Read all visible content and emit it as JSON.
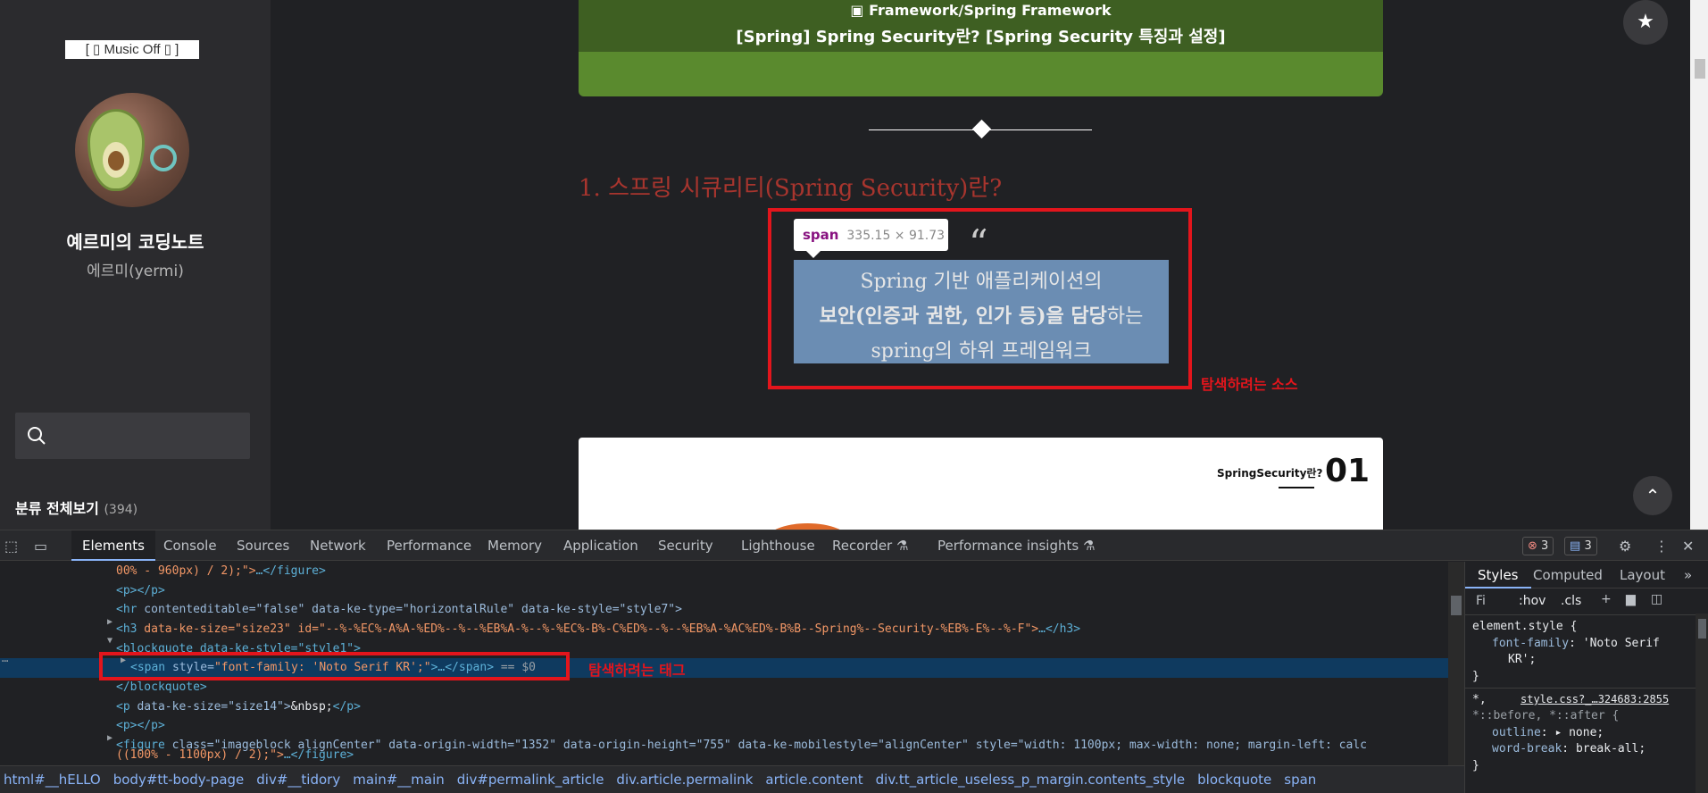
{
  "sidebar": {
    "music_label": "[ ▯ Music Off ▯ ]",
    "blog_title": "예르미의 코딩노트",
    "owner": "에르미(yermi)",
    "category_label": "분류 전체보기",
    "category_count": "(394)"
  },
  "article": {
    "category": "▣ Framework/Spring Framework",
    "title": "[Spring] Spring Security란? [Spring Security 특징과 설정]",
    "heading": "1. 스프링 시큐리티(Spring Security)란?",
    "quote_mark": "“",
    "quote_line1": "Spring 기반 애플리케이션의",
    "quote_line2_bold1": "보안(인증과 권한, 인가 등)을 담당",
    "quote_line2_rest": "하는",
    "quote_line3": "spring의 하위 프레임워크",
    "card_label": "SpringSecurity란?",
    "card_num": "01"
  },
  "inspect_tooltip": {
    "tag": "span",
    "size": "335.15 × 91.73"
  },
  "annotations": {
    "source": "탐색하려는 소스",
    "tag": "탐색하려는 태그"
  },
  "devtools": {
    "tabs": [
      "Elements",
      "Console",
      "Sources",
      "Network",
      "Performance",
      "Memory",
      "Application",
      "Security",
      "Lighthouse",
      "Recorder ⚗",
      "Performance insights ⚗"
    ],
    "errors": "3",
    "messages": "3",
    "code": {
      "l1_text": "00% - 960px) / 2);\">",
      "l1_close": "…</figure>",
      "l2": "<p></p>",
      "l3_tag": "<hr",
      "l3_attrs": " contenteditable=\"false\" data-ke-type=\"horizontalRule\" data-ke-style=\"style7\">",
      "l4_tag": "<h3",
      "l4_attrs": " data-ke-size=\"size23\" id=\"--%-%EC%-A%A-%ED%--%--%EB%A-%--%-%EC%-B%-C%ED%--%--%EB%A-%AC%ED%-B%B--Spring%--Security-%EB%-E%--%-F\">",
      "l4_close": "…</h3>",
      "l5": "<blockquote data-ke-style=\"style1\">",
      "l6_tag": "<span",
      "l6_attr": " style=",
      "l6_val": "\"font-family: 'Noto Serif KR';\"",
      "l6_close": ">…</span>",
      "l6_eq": " == $0",
      "l7": "</blockquote>",
      "l8_tag": "<p",
      "l8_attrs": " data-ke-size=\"size14\">",
      "l8_text": "&nbsp;",
      "l8_close": "</p>",
      "l9": "<p></p>",
      "l10_tag": "<figure",
      "l10_attrs": " class=\"imageblock alignCenter\" data-origin-width=\"1352\" data-origin-height=\"755\" data-ke-mobilestyle=\"alignCenter\" style=\"width: 1100px; max-width: none; margin-left: calc",
      "l11_text": "((100% - 1100px) / 2);\">",
      "l11_close": "…</figure>"
    },
    "breadcrumb": [
      "html#__hELLO",
      "body#tt-body-page",
      "div#__tidory",
      "main#__main",
      "div#permalink_article",
      "div.article.permalink",
      "article.content",
      "div.tt_article_useless_p_margin.contents_style",
      "blockquote",
      "span"
    ],
    "styles_tabs": [
      "Styles",
      "Computed",
      "Layout",
      "»"
    ],
    "filter_placeholder": "Fi",
    "hov": ":hov",
    "cls": ".cls",
    "rule1_selector": "element.style {",
    "rule1_prop": "font-family",
    "rule1_val": "'Noto Serif",
    "rule1_val2": "KR';",
    "rule_close": "}",
    "rule2_selector": "*,",
    "rule2_source": "style.css?_…324683:2855",
    "rule2_selector2": "*::before, *::after {",
    "rule2_prop1": "outline",
    "rule2_val1": "▸ none;",
    "rule2_prop2": "word-break",
    "rule2_val2": "break-all;"
  }
}
